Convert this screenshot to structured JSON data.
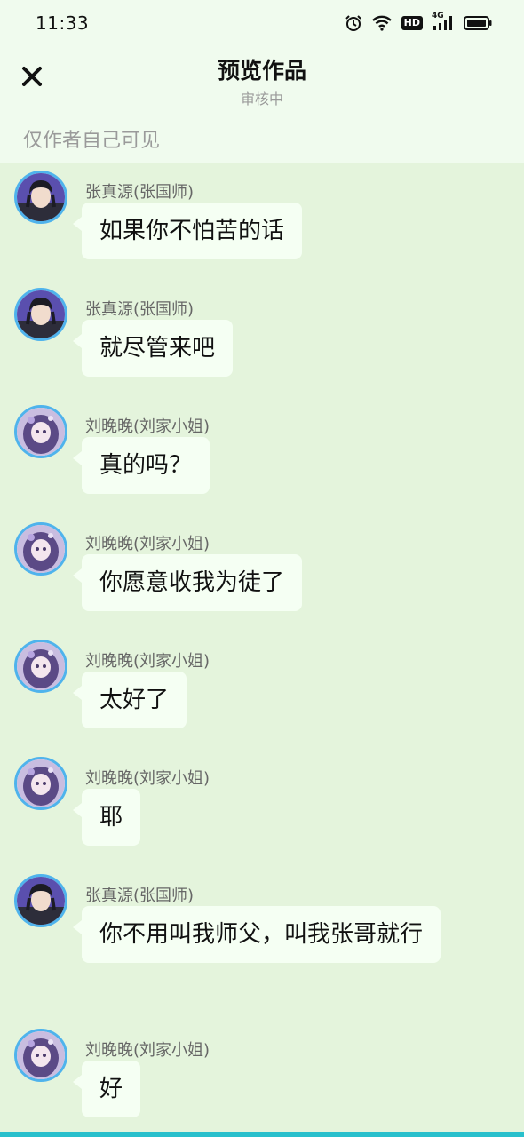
{
  "status_bar": {
    "time": "11:33",
    "icons": [
      "alarm-icon",
      "wifi-icon",
      "hd-icon",
      "signal-4g-icon",
      "battery-icon"
    ],
    "hd_label": "HD",
    "network_label": "4G"
  },
  "header": {
    "close_icon": "close-icon",
    "title": "预览作品",
    "subtitle": "审核中",
    "visibility_note": "仅作者自己可见"
  },
  "messages": [
    {
      "sender": "张真源(张国师)",
      "text": "如果你不怕苦的话",
      "avatar": "male"
    },
    {
      "sender": "张真源(张国师)",
      "text": "就尽管来吧",
      "avatar": "male"
    },
    {
      "sender": "刘晚晚(刘家小姐)",
      "text": "真的吗？",
      "avatar": "female"
    },
    {
      "sender": "刘晚晚(刘家小姐)",
      "text": "你愿意收我为徒了",
      "avatar": "female"
    },
    {
      "sender": "刘晚晚(刘家小姐)",
      "text": "太好了",
      "avatar": "female"
    },
    {
      "sender": "刘晚晚(刘家小姐)",
      "text": "耶",
      "avatar": "female"
    },
    {
      "sender": "张真源(张国师)",
      "text": "你不用叫我师父，叫我张哥就行",
      "avatar": "male"
    },
    {
      "sender": "刘晚晚(刘家小姐)",
      "text": "好",
      "avatar": "female"
    }
  ],
  "colors": {
    "background": "#e4f4dc",
    "header_background": "#f0fbee",
    "bubble": "#f5fff3",
    "avatar_ring": "#4fb3ec",
    "bottom_accent": "#29c0cc"
  }
}
